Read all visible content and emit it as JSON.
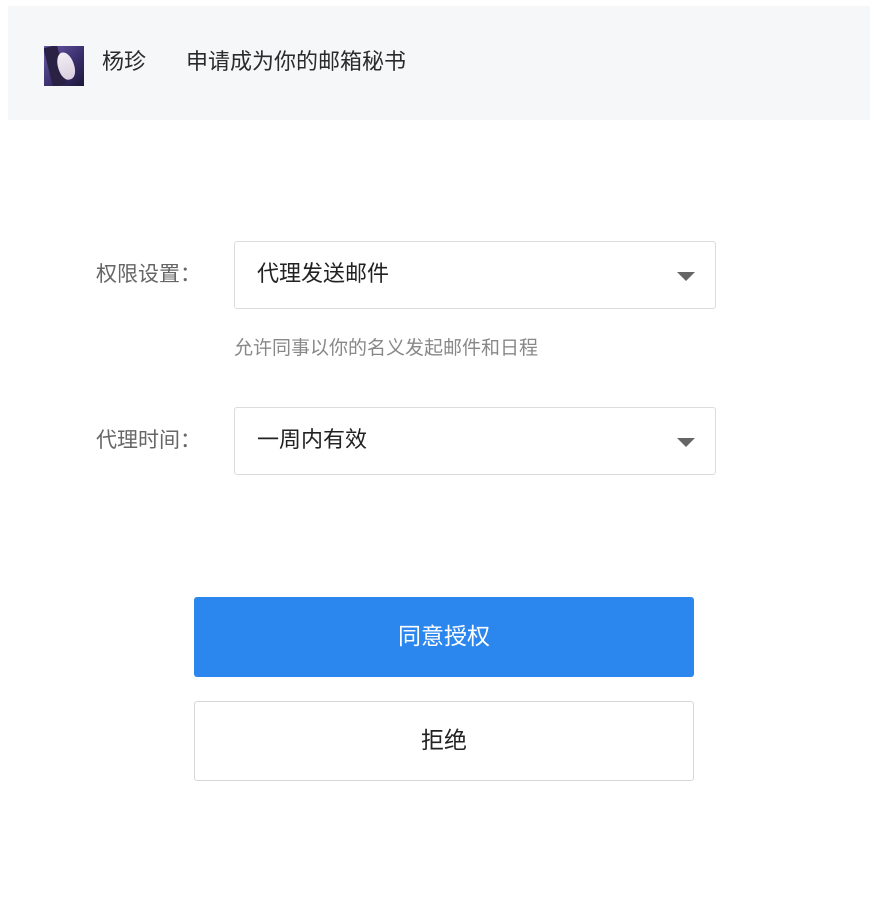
{
  "header": {
    "avatar_icon": "user-avatar",
    "requester_name": "杨珍",
    "request_message": "申请成为你的邮箱秘书"
  },
  "form": {
    "permission": {
      "label": "权限设置：",
      "selected": "代理发送邮件",
      "hint": "允许同事以你的名义发起邮件和日程"
    },
    "duration": {
      "label": "代理时间：",
      "selected": "一周内有效"
    }
  },
  "actions": {
    "approve_label": "同意授权",
    "reject_label": "拒绝"
  },
  "colors": {
    "primary": "#2b87ee",
    "header_bg": "#f6f7f9"
  }
}
